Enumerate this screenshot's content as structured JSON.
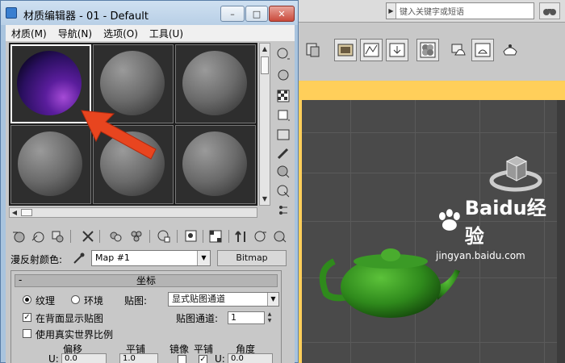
{
  "max_window": {
    "search_placeholder": "键入关键字或短语"
  },
  "material_editor": {
    "title": "材质编辑器 - 01 - Default",
    "window_buttons": [
      "–",
      "□",
      "✕"
    ],
    "menu": [
      "材质(M)",
      "导航(N)",
      "选项(O)",
      "工具(U)"
    ],
    "slots": [
      {
        "material": "purple",
        "active": true
      },
      {
        "material": "gray",
        "active": false
      },
      {
        "material": "gray",
        "active": false
      },
      {
        "material": "gray",
        "active": false
      },
      {
        "material": "gray",
        "active": false
      },
      {
        "material": "gray",
        "active": false
      }
    ],
    "diffuse_label": "漫反射颜色:",
    "map_name": "Map #1",
    "map_type_button": "Bitmap",
    "coordinates": {
      "collapse": "-",
      "title": "坐标",
      "texture_label": "纹理",
      "environ_label": "环境",
      "mapping_label": "贴图:",
      "mapping_value": "显式贴图通道",
      "show_back_label": "在背面显示贴图",
      "show_back_checked": true,
      "real_world_label": "使用真实世界比例",
      "real_world_checked": false,
      "map_channel_label": "贴图通道:",
      "map_channel_value": "1",
      "col_offset": "偏移",
      "col_tiling": "平铺",
      "col_mirror": "镜像",
      "col_tile": "平铺",
      "col_angle": "角度",
      "u_label": "U:",
      "u_offset": "0.0",
      "u_tiling": "1.0",
      "u_angle": "0.0"
    }
  },
  "colors": {
    "window_chrome": "#a9c4de",
    "panel_bg": "#c8c8c8",
    "slot_bg": "#2e2e2e",
    "arrow": "#e8451f",
    "teapot": "#2f8a1c",
    "viewport_border": "#ffcf5a"
  },
  "watermark": {
    "logo_text": "Baidu经验",
    "url": "jingyan.baidu.com"
  }
}
